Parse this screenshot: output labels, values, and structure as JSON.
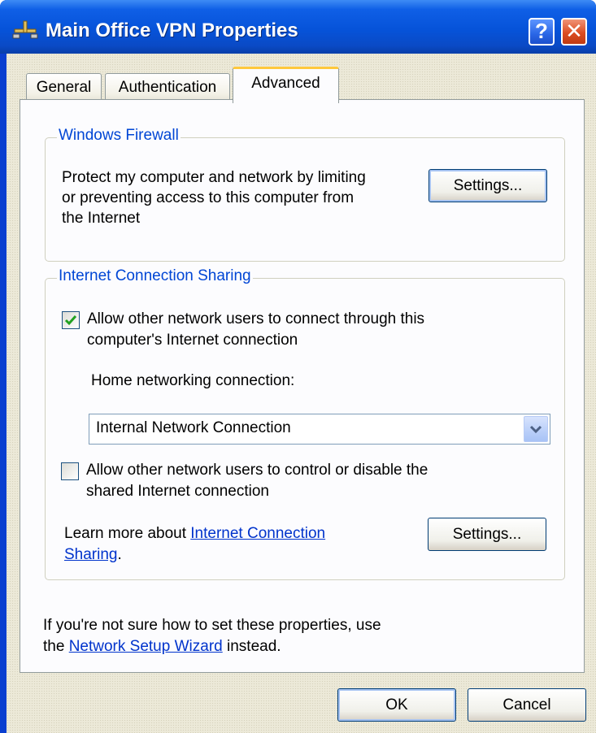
{
  "window": {
    "title": "Main Office VPN Properties",
    "help_label": "?",
    "close_label": "✕"
  },
  "tabs": [
    {
      "label": "General"
    },
    {
      "label": "Authentication"
    },
    {
      "label": "Advanced",
      "selected": true
    }
  ],
  "firewall": {
    "legend": "Windows Firewall",
    "description_lines": [
      "Protect my computer and network by limiting",
      "or preventing access to this computer from",
      "the Internet"
    ],
    "settings_label": "Settings..."
  },
  "ics": {
    "legend": "Internet Connection Sharing",
    "allow_connect": {
      "checked": true,
      "lines": [
        "Allow other network users to connect through this",
        "computer's Internet connection"
      ]
    },
    "home_label": "Home networking connection:",
    "home_value": "Internal Network Connection",
    "allow_control": {
      "checked": false,
      "lines": [
        "Allow other network users to control or disable the",
        "shared Internet connection"
      ]
    },
    "learn_prefix": "Learn more about ",
    "learn_link_line1": "Internet Connection",
    "learn_link_line2": "Sharing",
    "learn_suffix": ".",
    "settings_label": "Settings..."
  },
  "footer": {
    "line1": "If you're not sure how to set these properties, use",
    "line2_prefix": "the ",
    "wizard_link": "Network Setup Wizard",
    "line2_suffix": " instead."
  },
  "buttons": {
    "ok": "OK",
    "cancel": "Cancel"
  },
  "colors": {
    "titlebar": "#0653d9",
    "accent_text": "#0046d5",
    "link": "#0033cc",
    "selected_tab_highlight": "#ffc83c",
    "close_button": "#dc4d22",
    "check": "#21a121"
  },
  "icons": [
    "network-connection-icon",
    "help-icon",
    "close-icon",
    "checkmark-icon",
    "dropdown-chevron-icon"
  ]
}
